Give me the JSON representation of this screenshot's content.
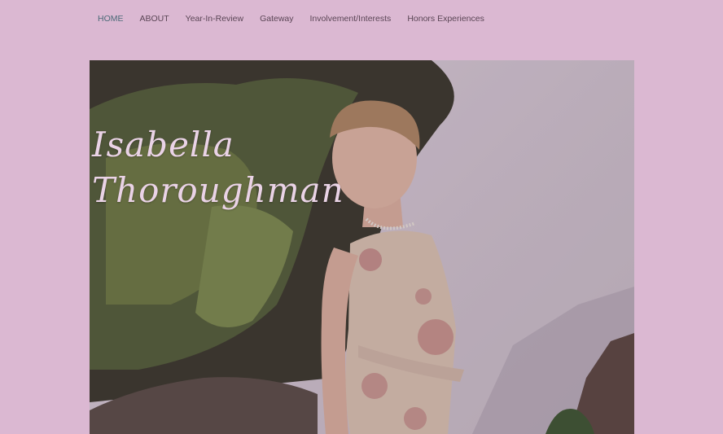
{
  "nav": {
    "items": [
      {
        "label": "HOME",
        "active": true
      },
      {
        "label": "ABOUT",
        "active": false
      },
      {
        "label": "Year-In-Review",
        "active": false
      },
      {
        "label": "Gateway",
        "active": false
      },
      {
        "label": "Involvement/Interests",
        "active": false
      },
      {
        "label": "Honors Experiences",
        "active": false
      }
    ]
  },
  "hero": {
    "title_line1": "Isabella",
    "title_line2": "Thoroughman"
  },
  "colors": {
    "page_background": "#dbb8d2",
    "nav_text": "#5b4656",
    "nav_active": "#4c6a78",
    "hero_title": "#ead3e6"
  }
}
